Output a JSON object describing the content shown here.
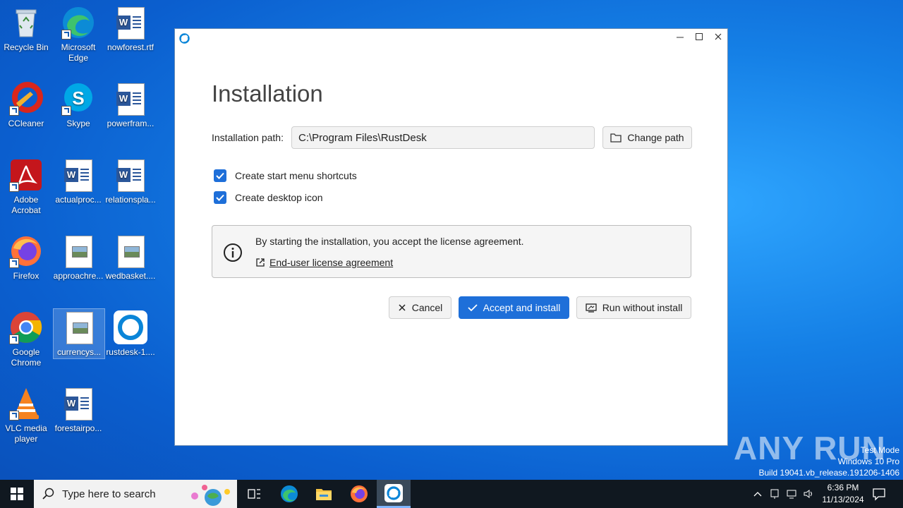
{
  "desktop": {
    "icons": [
      {
        "label": "Recycle Bin",
        "icon": "recycle-bin-icon"
      },
      {
        "label": "Microsoft Edge",
        "icon": "edge-icon"
      },
      {
        "label": "nowforest.rtf",
        "icon": "word-doc-icon"
      },
      {
        "label": "CCleaner",
        "icon": "ccleaner-icon"
      },
      {
        "label": "Skype",
        "icon": "skype-icon"
      },
      {
        "label": "powerfram...",
        "icon": "word-doc-icon"
      },
      {
        "label": "Adobe Acrobat",
        "icon": "acrobat-icon"
      },
      {
        "label": "actualproc...",
        "icon": "word-doc-icon"
      },
      {
        "label": "relationspla...",
        "icon": "word-doc-icon"
      },
      {
        "label": "Firefox",
        "icon": "firefox-icon"
      },
      {
        "label": "approachre...",
        "icon": "image-file-icon"
      },
      {
        "label": "wedbasket....",
        "icon": "image-file-icon"
      },
      {
        "label": "Google Chrome",
        "icon": "chrome-icon"
      },
      {
        "label": "currencys...",
        "icon": "image-file-icon"
      },
      {
        "label": "rustdesk-1....",
        "icon": "rustdesk-icon"
      },
      {
        "label": "VLC media player",
        "icon": "vlc-icon"
      },
      {
        "label": "forestairpo...",
        "icon": "word-doc-icon"
      }
    ]
  },
  "installer": {
    "title": "Installation",
    "path_label": "Installation path:",
    "path_value": "C:\\Program Files\\RustDesk",
    "change_path_label": "Change path",
    "options": [
      {
        "label": "Create start menu shortcuts",
        "checked": true
      },
      {
        "label": "Create desktop icon",
        "checked": true
      }
    ],
    "notice_text": "By starting the installation, you accept the license agreement.",
    "eula_label": "End-user license agreement",
    "cancel_label": "Cancel",
    "accept_label": "Accept and install",
    "run_without_label": "Run without install",
    "accent_color": "#1e6fd9"
  },
  "watermark": {
    "text": "ANY RUN",
    "line1": "Test Mode",
    "line2": "Windows 10 Pro",
    "line3": "Build 19041.vb_release.191206-1406"
  },
  "taskbar": {
    "search_placeholder": "Type here to search",
    "time": "6:36 PM",
    "date": "11/13/2024"
  }
}
